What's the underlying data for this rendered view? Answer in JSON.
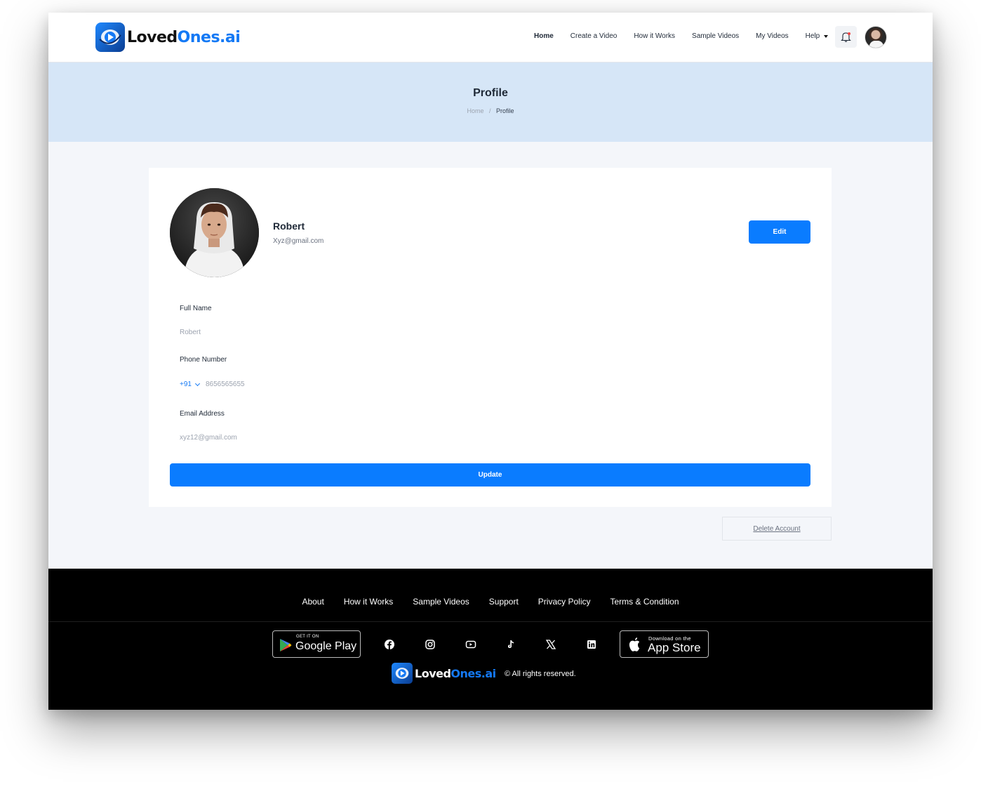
{
  "brand": {
    "part1": "Loved",
    "part2": "Ones.ai"
  },
  "nav": {
    "items": [
      {
        "label": "Home",
        "active": true
      },
      {
        "label": "Create a Video"
      },
      {
        "label": "How it Works"
      },
      {
        "label": "Sample Videos"
      },
      {
        "label": "My Videos"
      }
    ],
    "help": "Help"
  },
  "banner": {
    "title": "Profile",
    "breadcrumb": {
      "home": "Home",
      "separator": "/",
      "current": "Profile"
    }
  },
  "profile": {
    "name": "Robert",
    "email": "Xyz@gmail.com",
    "edit_label": "Edit"
  },
  "form": {
    "full_name_label": "Full Name",
    "full_name_value": "Robert",
    "phone_label": "Phone Number",
    "phone_code": "+91",
    "phone_value": "8656565655",
    "email_label": "Email Address",
    "email_value": "xyz12@gmail.com",
    "update_label": "Update"
  },
  "delete_account": "Delete Account",
  "footer": {
    "links": [
      "About",
      "How it Works",
      "Sample Videos",
      "Support",
      "Privacy Policy",
      "Terms & Condition"
    ],
    "google_play": {
      "small": "GET IT ON",
      "big": "Google Play"
    },
    "app_store": {
      "small": "Download on the",
      "big": "App Store"
    },
    "social": [
      "facebook-icon",
      "instagram-icon",
      "youtube-icon",
      "tiktok-icon",
      "x-icon",
      "linkedin-icon"
    ],
    "copyright": "© All rights reserved."
  },
  "colors": {
    "accent": "#0a7cff",
    "banner": "#d6e6f7",
    "footer": "#000000"
  }
}
